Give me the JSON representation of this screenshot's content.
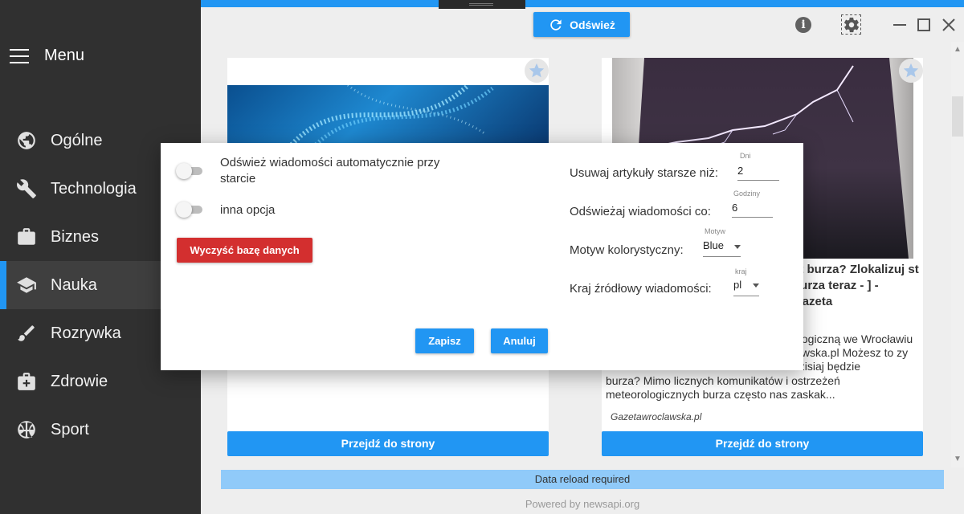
{
  "sidebar": {
    "menu_label": "Menu",
    "items": [
      {
        "label": "Ogólne",
        "icon": "globe-icon"
      },
      {
        "label": "Technologia",
        "icon": "wrench-icon"
      },
      {
        "label": "Biznes",
        "icon": "briefcase-icon"
      },
      {
        "label": "Nauka",
        "icon": "graduation-cap-icon",
        "active": true
      },
      {
        "label": "Rozrywka",
        "icon": "brush-icon"
      },
      {
        "label": "Zdrowie",
        "icon": "medical-kit-icon"
      },
      {
        "label": "Sport",
        "icon": "basketball-icon"
      }
    ],
    "accent_color": "#2196f3"
  },
  "toolbar": {
    "refresh_label": "Odśwież",
    "info_glyph": "i"
  },
  "cards": [
    {
      "go_label": "Przejdź do strony"
    },
    {
      "title": "st burza? Zlokalizuj st burza teraz - ] - Gazeta",
      "description": "burza? Mimo licznych komunikatów i ostrzeżeń meteorologicznych burza często nas zaskak...",
      "description_partial": "ologiczną we Wrocławiu lawska.pl Możesz to zy dzisiaj będzie",
      "source": "Gazetawroclawska.pl",
      "go_label": "Przejdź do strony"
    }
  ],
  "status": {
    "message": "Data reload required"
  },
  "footer": {
    "powered": "Powered by newsapi.org"
  },
  "dialog": {
    "auto_refresh_label": "Odśwież wiadomości automatycznie przy starcie",
    "auto_refresh_on": false,
    "other_option_label": "inna opcja",
    "other_option_on": false,
    "clear_db_label": "Wyczyść bazę danych",
    "delete_older_label": "Usuwaj artykuły starsze niż:",
    "days_caption": "Dni",
    "days_value": "2",
    "refresh_every_label": "Odświeżaj wiadomości co:",
    "hours_caption": "Godziny",
    "hours_value": "6",
    "theme_label": "Motyw kolorystyczny:",
    "theme_caption": "Motyw",
    "theme_value": "Blue",
    "country_label": "Kraj źródłowy wiadomości:",
    "country_caption": "kraj",
    "country_value": "pl",
    "save_label": "Zapisz",
    "cancel_label": "Anuluj"
  }
}
